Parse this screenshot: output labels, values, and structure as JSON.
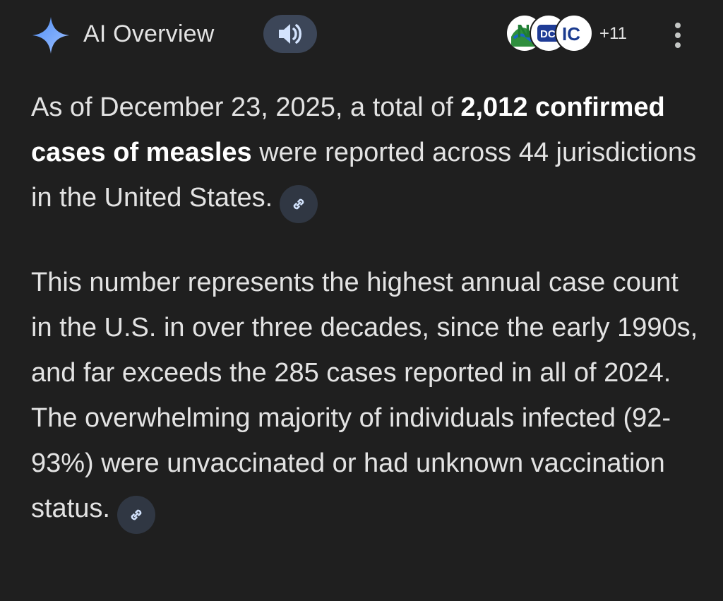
{
  "header": {
    "title": "AI Overview",
    "listen_icon": "speaker-icon",
    "sources": {
      "favicons": [
        {
          "icon": "n-favicon-icon",
          "text": "N"
        },
        {
          "icon": "dc-favicon-icon",
          "text": "DC"
        },
        {
          "icon": "ic-favicon-icon",
          "text": "IC"
        }
      ],
      "more_count": "+11"
    },
    "menu_icon": "more-vert-icon"
  },
  "body": {
    "para1": {
      "lead": "As of December 23, 2025, a total of ",
      "bold": "2,012 confirmed cases of measles",
      "tail": " were reported across 44 jurisdictions in the United States.",
      "link_icon": "link-icon"
    },
    "para2": {
      "text": "This number represents the highest annual case count in the U.S. in over three decades, since the early 1990s, and far exceeds the 285 cases reported in all of 2024. The overwhelming majority of individuals infected (92-93%) were unvaccinated or had unknown vaccination status.",
      "link_icon": "link-icon"
    }
  },
  "colors": {
    "background": "#1f1f1f",
    "text": "#e3e3e3",
    "accent": "#7aa2f7",
    "chip_bg": "#303743",
    "speaker_bg": "#3c4658"
  }
}
